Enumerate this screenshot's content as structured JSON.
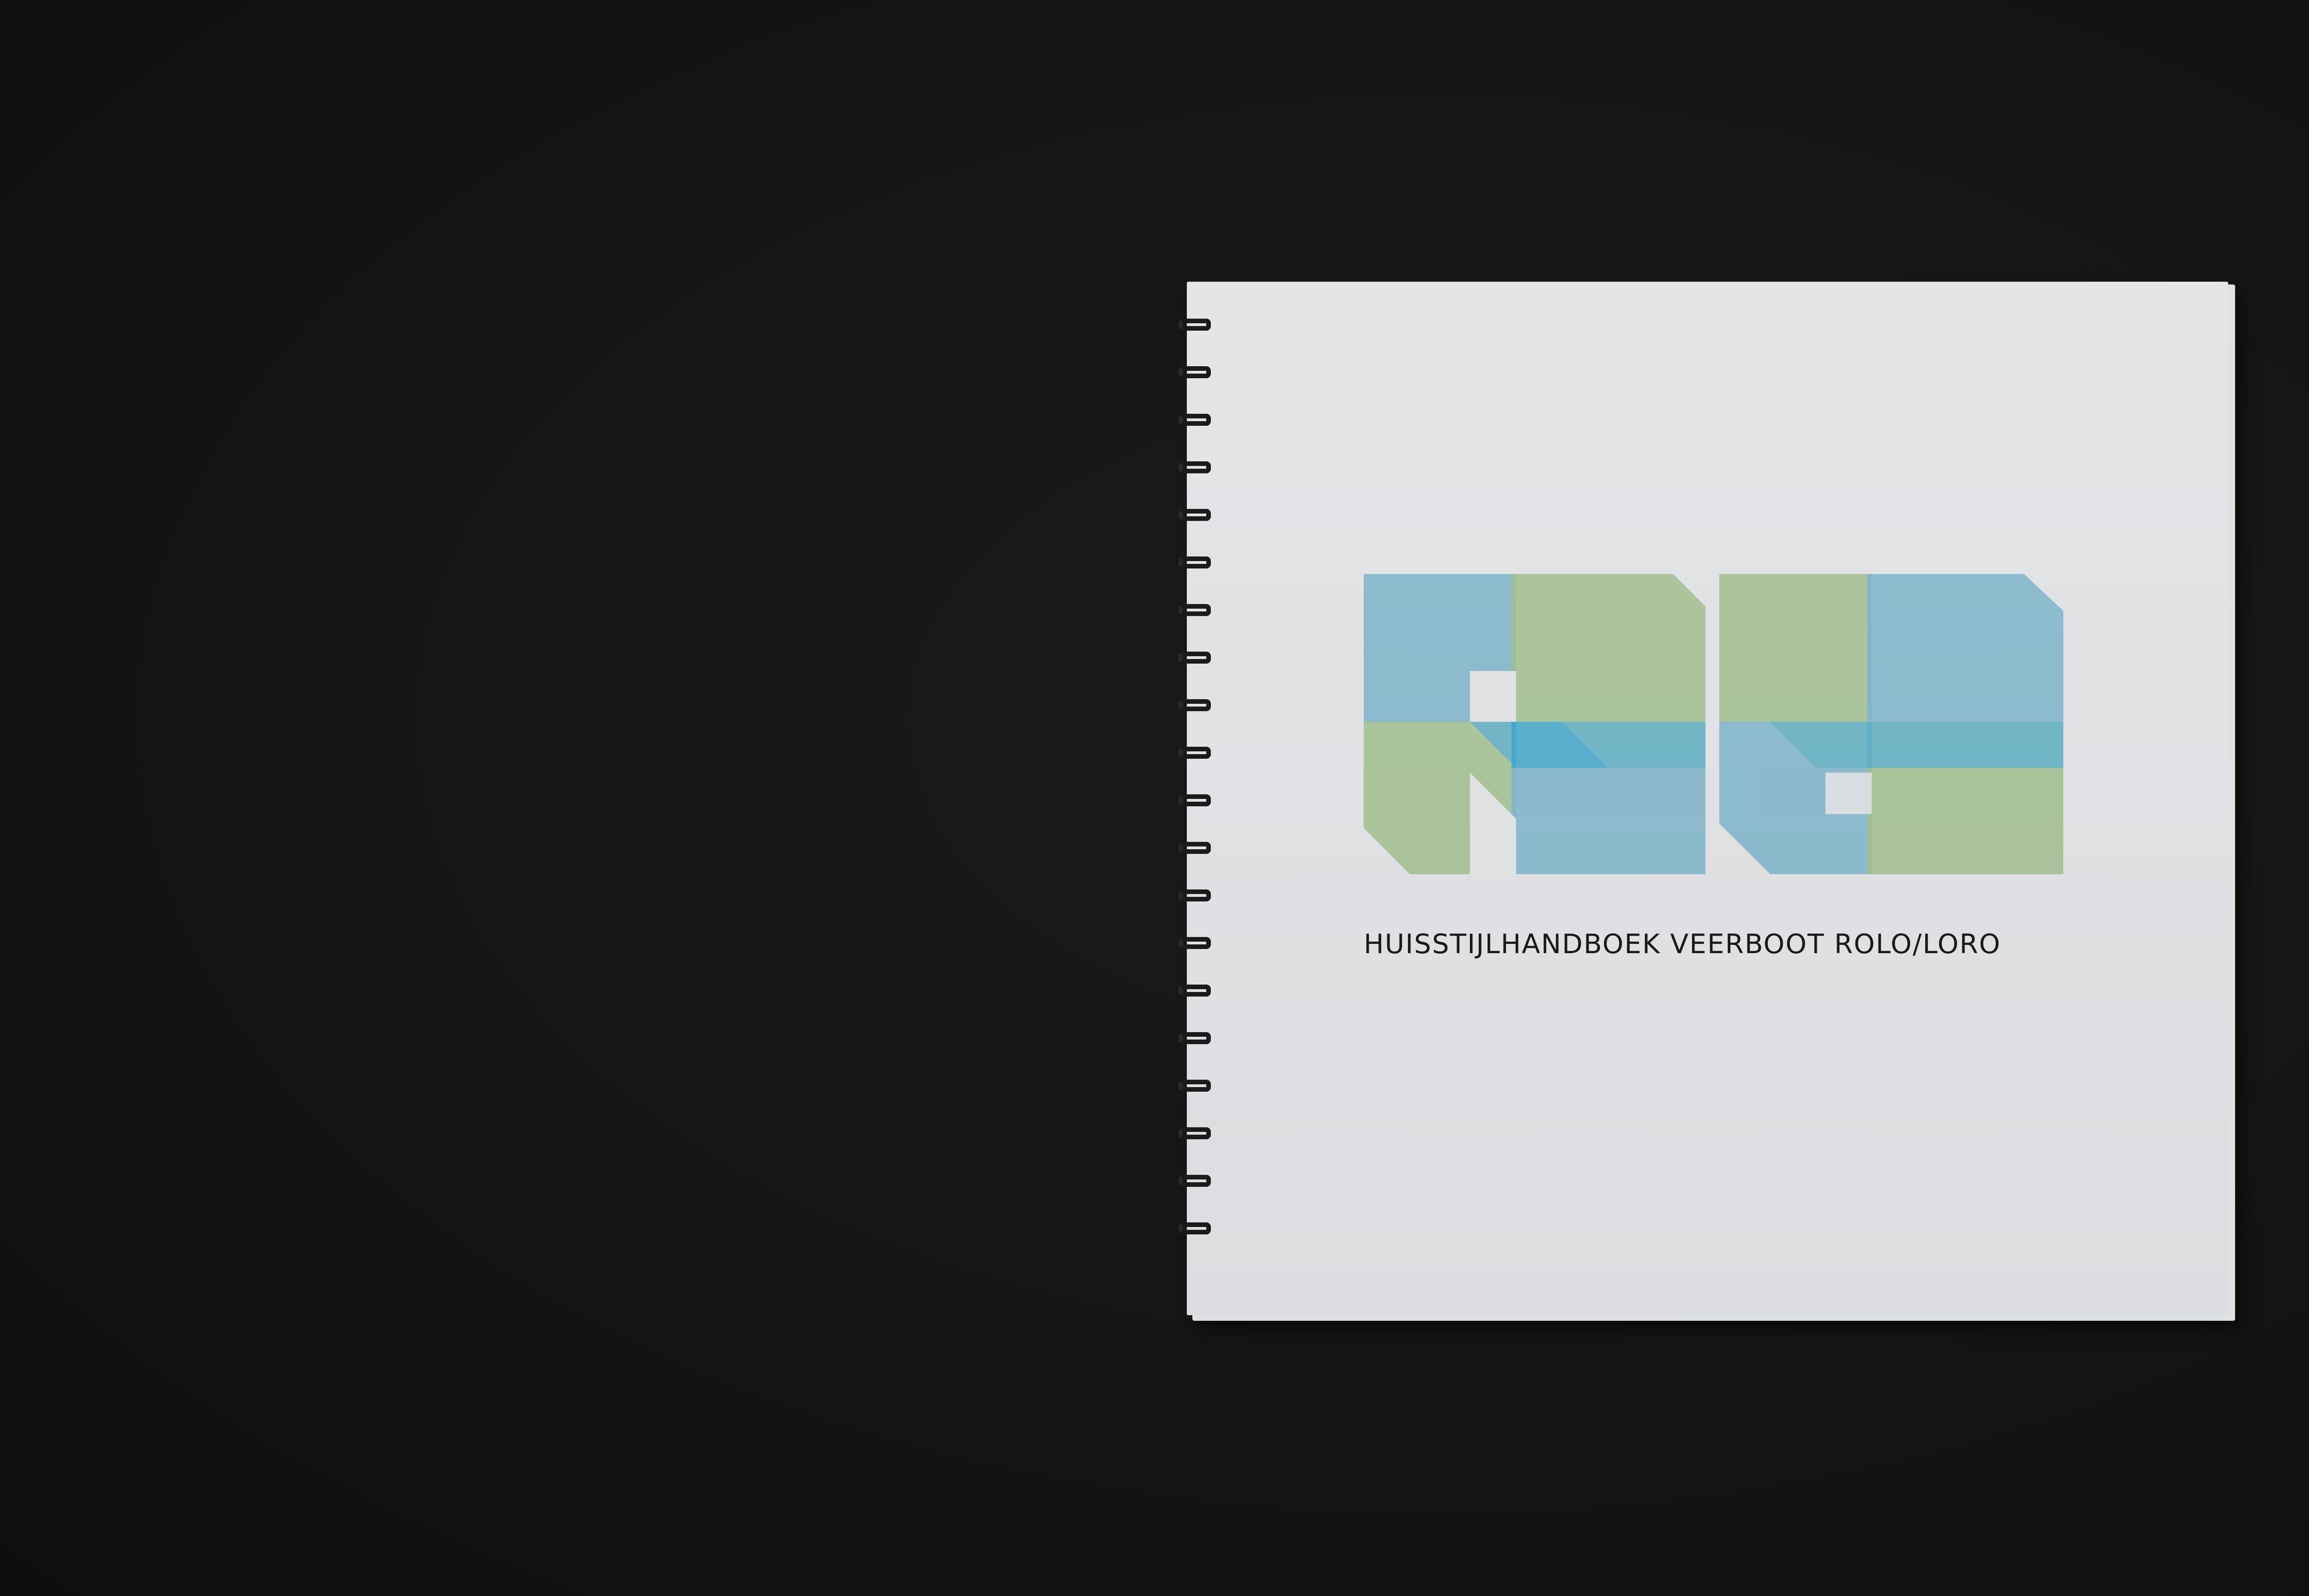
{
  "photo": {
    "subject": "spiral-bound square booklet on black surface",
    "cover": {
      "title": "HUISSTIJLHANDBOEK VEERBOOT ROLO/LORO",
      "logo": {
        "lettering": "ROLO",
        "colors": {
          "blue": "#8fcbe3",
          "green": "#b7d7a0",
          "overlap": "#6cc7d9",
          "bright": "#34b4e6"
        }
      }
    },
    "colors": {
      "background": "#151412",
      "paper": "#e2e3e5",
      "text": "#1a1a1a",
      "binding": "#1b1b1c"
    },
    "binding_ring_count": 20
  }
}
